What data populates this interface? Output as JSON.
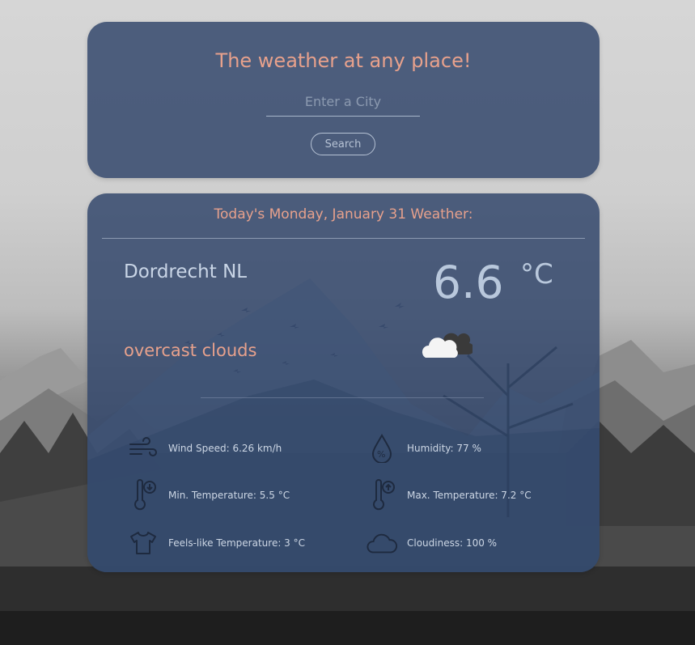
{
  "search": {
    "title": "The weather at any place!",
    "placeholder": "Enter a City",
    "value": "",
    "button_label": "Search"
  },
  "weather": {
    "date_heading": "Today's Monday, January 31 Weather:",
    "city": "Dordrecht NL",
    "temperature": "6.6",
    "unit": "°C",
    "description": "overcast clouds",
    "icon": "overcast-clouds-icon",
    "stats": {
      "wind": {
        "label": "Wind Speed: 6.26 km/h",
        "icon": "wind-icon"
      },
      "humidity": {
        "label": "Humidity: 77 %",
        "icon": "humidity-drop-icon"
      },
      "min_temp": {
        "label": "Min. Temperature: 5.5 °C",
        "icon": "thermometer-down-icon"
      },
      "max_temp": {
        "label": "Max. Temperature: 7.2 °C",
        "icon": "thermometer-up-icon"
      },
      "feels_like": {
        "label": "Feels-like Temperature: 3 °C",
        "icon": "tshirt-icon"
      },
      "cloudiness": {
        "label": "Cloudiness: 100 %",
        "icon": "cloud-icon"
      }
    }
  },
  "colors": {
    "accent": "#e7a18c",
    "card": "#34486c",
    "text": "#c9d5e6"
  }
}
